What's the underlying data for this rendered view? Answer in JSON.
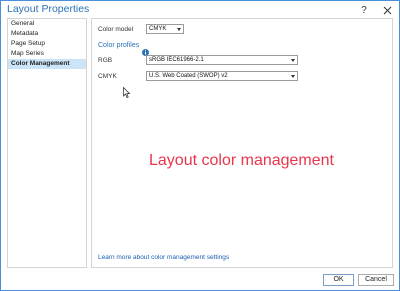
{
  "window": {
    "title": "Layout Properties",
    "help_icon": "question-mark-icon",
    "close_icon": "close-icon"
  },
  "sidebar": {
    "items": [
      {
        "label": "General"
      },
      {
        "label": "Metadata"
      },
      {
        "label": "Page Setup"
      },
      {
        "label": "Map Series"
      },
      {
        "label": "Color Management",
        "selected": true
      }
    ]
  },
  "content": {
    "color_model_label": "Color model",
    "color_model_value": "CMYK",
    "color_profiles_heading": "Color profiles",
    "info_icon": "info-icon",
    "rgb_label": "RGB",
    "rgb_value": "sRGB IEC61966-2.1",
    "cmyk_label": "CMYK",
    "cmyk_value": "U.S. Web Coated (SWOP) v2",
    "annotation": "Layout color management",
    "learn_more_link": "Learn more about color management settings"
  },
  "footer": {
    "ok_label": "OK",
    "cancel_label": "Cancel"
  },
  "colors": {
    "accent": "#2a72b8",
    "selected_bg": "#cce4f7",
    "annotation": "#e8364c",
    "link": "#1a5fb4"
  }
}
